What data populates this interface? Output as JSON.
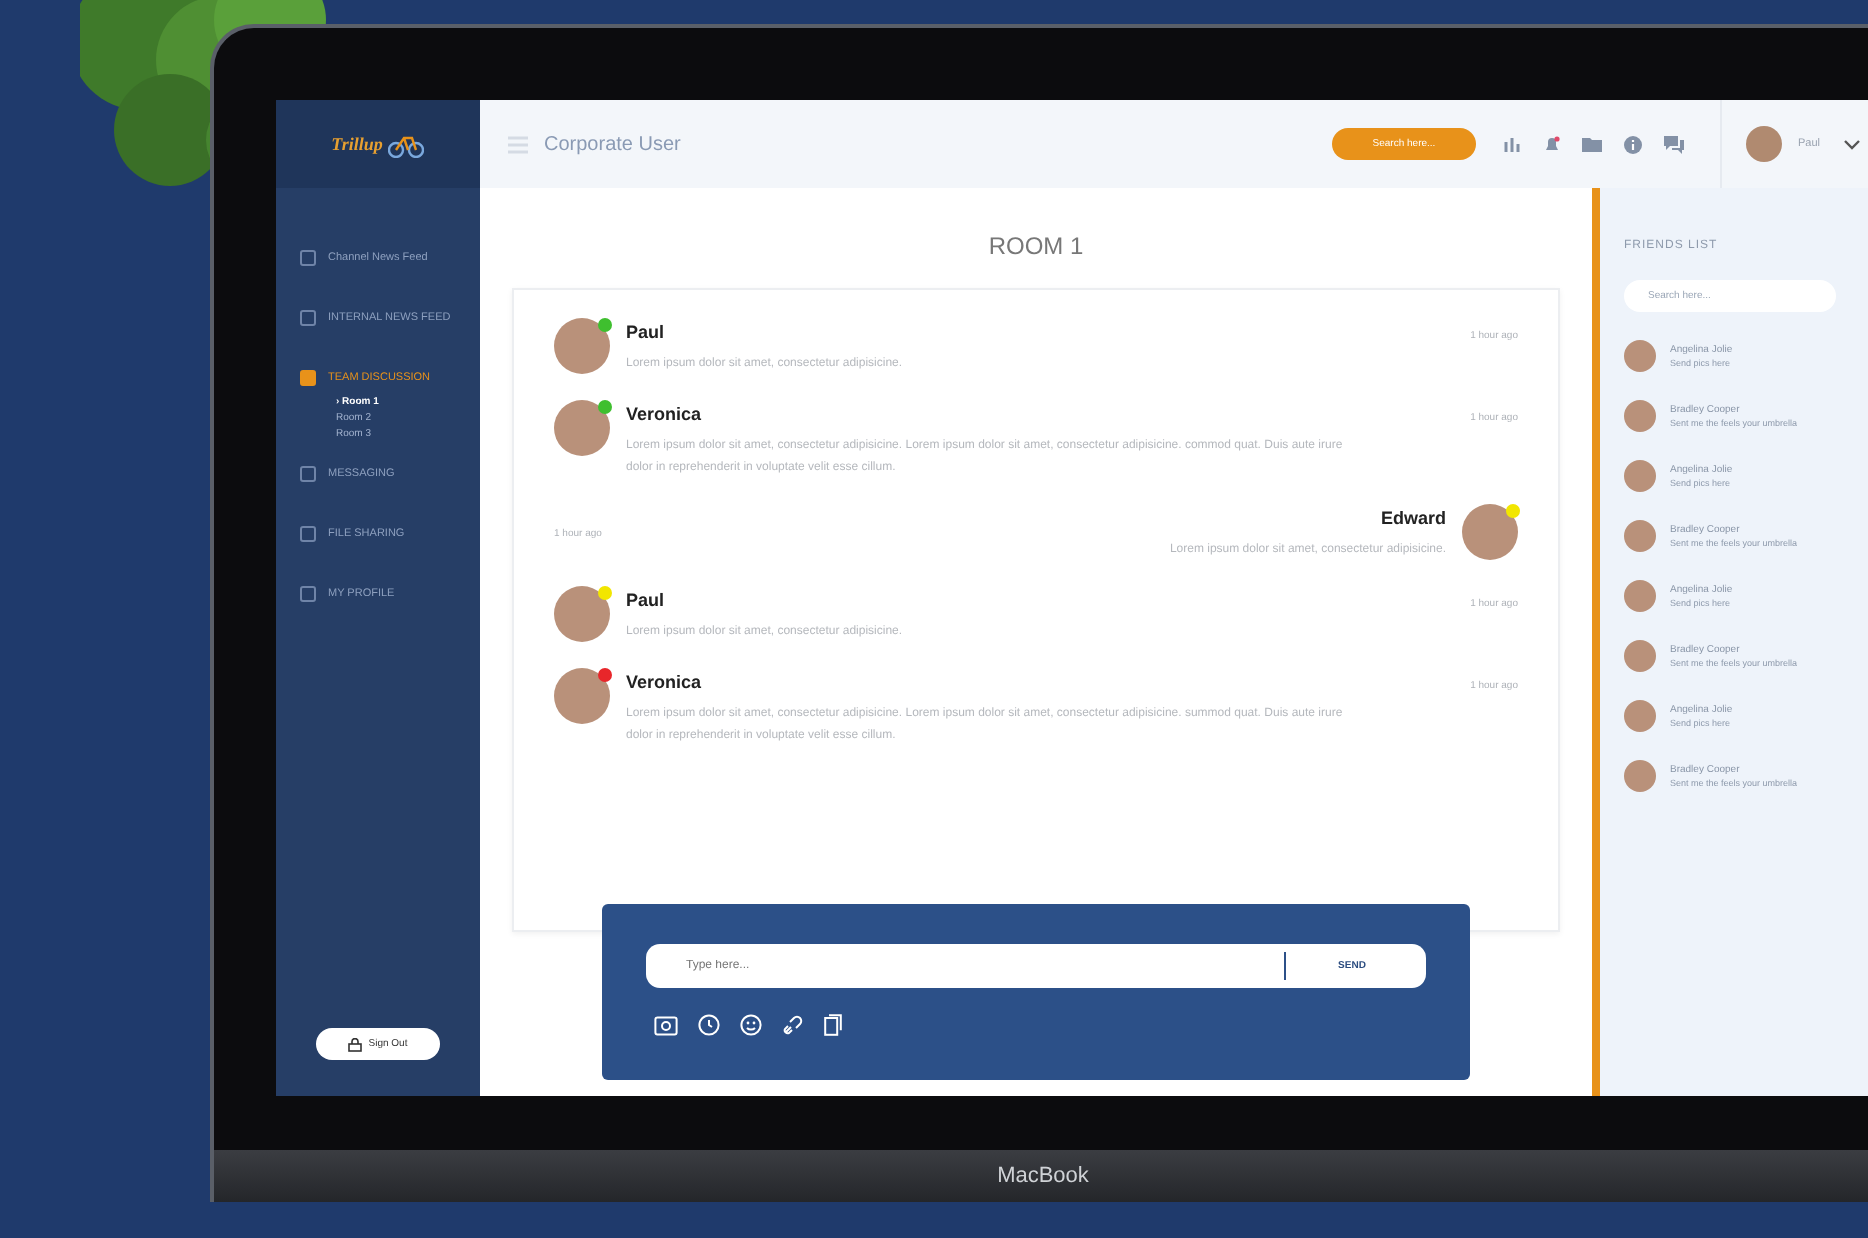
{
  "device": {
    "label": "MacBook"
  },
  "sidebar": {
    "logo": "Trillup",
    "items": [
      {
        "label": "Channel News Feed",
        "selected": false
      },
      {
        "label": "INTERNAL NEWS FEED",
        "selected": false
      },
      {
        "label": "TEAM DISCUSSION",
        "selected": true,
        "children": [
          {
            "label": "› Room 1",
            "selected": true
          },
          {
            "label": "Room 2",
            "selected": false
          },
          {
            "label": "Room 3",
            "selected": false
          }
        ]
      },
      {
        "label": "MESSAGING",
        "selected": false
      },
      {
        "label": "FILE SHARING",
        "selected": false
      },
      {
        "label": "MY PROFILE",
        "selected": false
      }
    ],
    "sign_out": "Sign Out"
  },
  "topbar": {
    "title": "Corporate User",
    "search": {
      "placeholder": "Search here..."
    },
    "user": "Paul"
  },
  "chat": {
    "title": "ROOM 1",
    "messages": [
      {
        "kind": "received",
        "name": "Paul",
        "color": "#3fbf2f",
        "time": "1 hour ago",
        "text": "Lorem ipsum dolor sit amet, consectetur adipisicine."
      },
      {
        "kind": "received",
        "name": "Veronica",
        "color": "#3fbf2f",
        "time": "1 hour ago",
        "text": "Lorem ipsum dolor sit amet, consectetur adipisicine. Lorem ipsum dolor sit amet, consectetur adipisicine. commod quat. Duis aute irure dolor in reprehenderit in voluptate velit esse cillum."
      },
      {
        "kind": "sent",
        "name": "Edward",
        "color": "#f2e600",
        "time": "1 hour ago",
        "text": "Lorem ipsum dolor sit amet, consectetur adipisicine."
      },
      {
        "kind": "received",
        "name": "Paul",
        "color": "#f2e600",
        "time": "1 hour ago",
        "text": "Lorem ipsum dolor sit amet, consectetur adipisicine."
      },
      {
        "kind": "received",
        "name": "Veronica",
        "color": "#e8262a",
        "time": "1 hour ago",
        "text": "Lorem ipsum dolor sit amet, consectetur adipisicine. Lorem ipsum dolor sit amet, consectetur adipisicine. summod quat. Duis aute irure dolor in reprehenderit in voluptate velit esse cillum."
      }
    ],
    "composer": {
      "placeholder": "Type here...",
      "send": "SEND"
    }
  },
  "friends": {
    "title": "FRIENDS LIST",
    "search": {
      "placeholder": "Search here..."
    },
    "items": [
      {
        "name": "Angelina Jolie",
        "status": "Send pics here"
      },
      {
        "name": "Bradley Cooper",
        "status": "Sent me the feels your umbrella"
      },
      {
        "name": "Angelina Jolie",
        "status": "Send pics here"
      },
      {
        "name": "Bradley Cooper",
        "status": "Sent me the feels your umbrella"
      },
      {
        "name": "Angelina Jolie",
        "status": "Send pics here"
      },
      {
        "name": "Bradley Cooper",
        "status": "Sent me the feels your umbrella"
      },
      {
        "name": "Angelina Jolie",
        "status": "Send pics here"
      },
      {
        "name": "Bradley Cooper",
        "status": "Sent me the feels your umbrella"
      }
    ]
  }
}
